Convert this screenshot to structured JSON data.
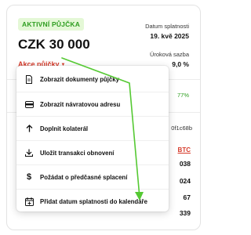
{
  "loan": {
    "badge": "AKTIVNÍ PŮJČKA",
    "amount": "CZK 30 000",
    "actions_label": "Akce půjčky",
    "due_label": "Datum splatnosti",
    "due_date": "19. kvě 2025",
    "rate_label": "Úroková sazba",
    "rate_value": "9,0 %"
  },
  "background": {
    "percent": "77%",
    "hash": "0f1c68b",
    "btc": "BTC",
    "values": [
      "038",
      "024",
      "67",
      "339"
    ]
  },
  "menu": {
    "items": [
      {
        "label": "Zobrazit dokumenty půjčky",
        "icon": "document-icon"
      },
      {
        "label": "Zobrazit návratovou adresu",
        "icon": "wallet-icon"
      },
      {
        "label": "Doplnit kolaterál",
        "icon": "arrow-up-icon"
      },
      {
        "label": "Uložit transakci obnovení",
        "icon": "download-icon"
      },
      {
        "label": "Požádat o předčasné splacení",
        "icon": "dollar-icon"
      },
      {
        "label": "Přidat datum splatnosti do kalendáře",
        "icon": "calendar-add-icon"
      }
    ]
  },
  "colors": {
    "accent_red": "#d63a2a",
    "badge_green": "#2e9e20",
    "arrow_green": "#55c933"
  }
}
